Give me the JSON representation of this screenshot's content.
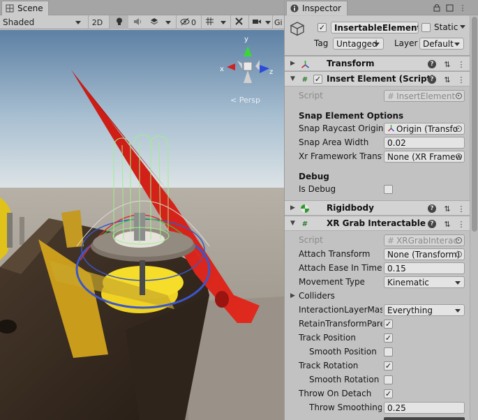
{
  "scene": {
    "tab_label": "Scene",
    "shading_mode": "Shaded",
    "mode_2d": "2D",
    "hidden_count": "0",
    "gizmos_label": "Gi",
    "persp_label": "< Persp",
    "axes": {
      "x": "x",
      "y": "y",
      "z": "z"
    }
  },
  "inspector": {
    "tab_label": "Inspector",
    "object": {
      "name": "InsertableElement",
      "active": true,
      "static_label": "Static",
      "static_checked": false,
      "tag_label": "Tag",
      "tag_value": "Untagged",
      "layer_label": "Layer",
      "layer_value": "Default"
    },
    "transform": {
      "title": "Transform"
    },
    "insert_element": {
      "title": "Insert Element (Script)",
      "enabled": true,
      "script_label": "Script",
      "script_value": "InsertElement",
      "section_snap": "Snap Element Options",
      "snap_raycast_label": "Snap Raycast Origin",
      "snap_raycast_value": "Origin (Transfo",
      "snap_area_label": "Snap Area Width",
      "snap_area_value": "0.02",
      "xr_framework_label": "Xr Framework Transfo",
      "xr_framework_value": "None (XR Framew",
      "section_debug": "Debug",
      "is_debug_label": "Is Debug",
      "is_debug": false
    },
    "rigidbody": {
      "title": "Rigidbody"
    },
    "xr_grab": {
      "title": "XR Grab Interactable",
      "script_label": "Script",
      "script_value": "XRGrabInterac",
      "attach_transform_label": "Attach Transform",
      "attach_transform_value": "None (Transform)",
      "attach_ease_label": "Attach Ease In Time",
      "attach_ease_value": "0.15",
      "movement_type_label": "Movement Type",
      "movement_type_value": "Kinematic",
      "colliders_label": "Colliders",
      "interaction_layer_label": "InteractionLayerMask",
      "interaction_layer_value": "Everything",
      "retain_transform_label": "RetainTransformParent",
      "retain_transform": true,
      "track_position_label": "Track Position",
      "track_position": true,
      "smooth_position_label": "Smooth Position",
      "smooth_position": false,
      "track_rotation_label": "Track Rotation",
      "track_rotation": true,
      "smooth_rotation_label": "Smooth Rotation",
      "smooth_rotation": false,
      "throw_on_detach_label": "Throw On Detach",
      "throw_on_detach": true,
      "throw_smoothing_label": "Throw Smoothing Duration",
      "throw_smoothing_value": "0.25"
    }
  }
}
